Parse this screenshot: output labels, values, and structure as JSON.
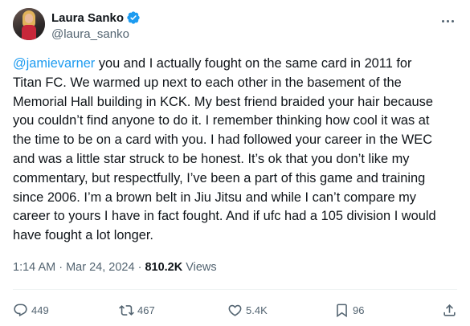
{
  "author": {
    "display_name": "Laura Sanko",
    "handle": "@laura_sanko",
    "verified": true
  },
  "tweet": {
    "mention": "@jamievarner",
    "lines": [
      " you and I actually fought on the same card in 2011 for",
      "Titan FC. We warmed up next to each other in the basement of the",
      "Memorial Hall building in KCK. My best friend braided your hair because",
      "you couldn’t find anyone to do it. I remember thinking how cool it was at",
      "the time to be on a card with you. I had followed your career in the WEC",
      "and was a little star struck to be honest. It’s ok that you don’t like my",
      "commentary, but respectfully, I’ve been a part of this game and training",
      "since 2006. I’m a brown belt in Jiu Jitsu and while I can’t compare my",
      "career to yours I have in fact fought. And if ufc had a 105 division I would",
      "have fought a lot longer."
    ]
  },
  "meta": {
    "time": "1:14 AM",
    "separator": " · ",
    "date": "Mar 24, 2024",
    "views_count": "810.2K",
    "views_label": " Views"
  },
  "actions": {
    "replies": "449",
    "reposts": "467",
    "likes": "5.4K",
    "bookmarks": "96"
  },
  "colors": {
    "accent": "#1d9bf0",
    "text": "#0f1419",
    "muted": "#536471"
  }
}
